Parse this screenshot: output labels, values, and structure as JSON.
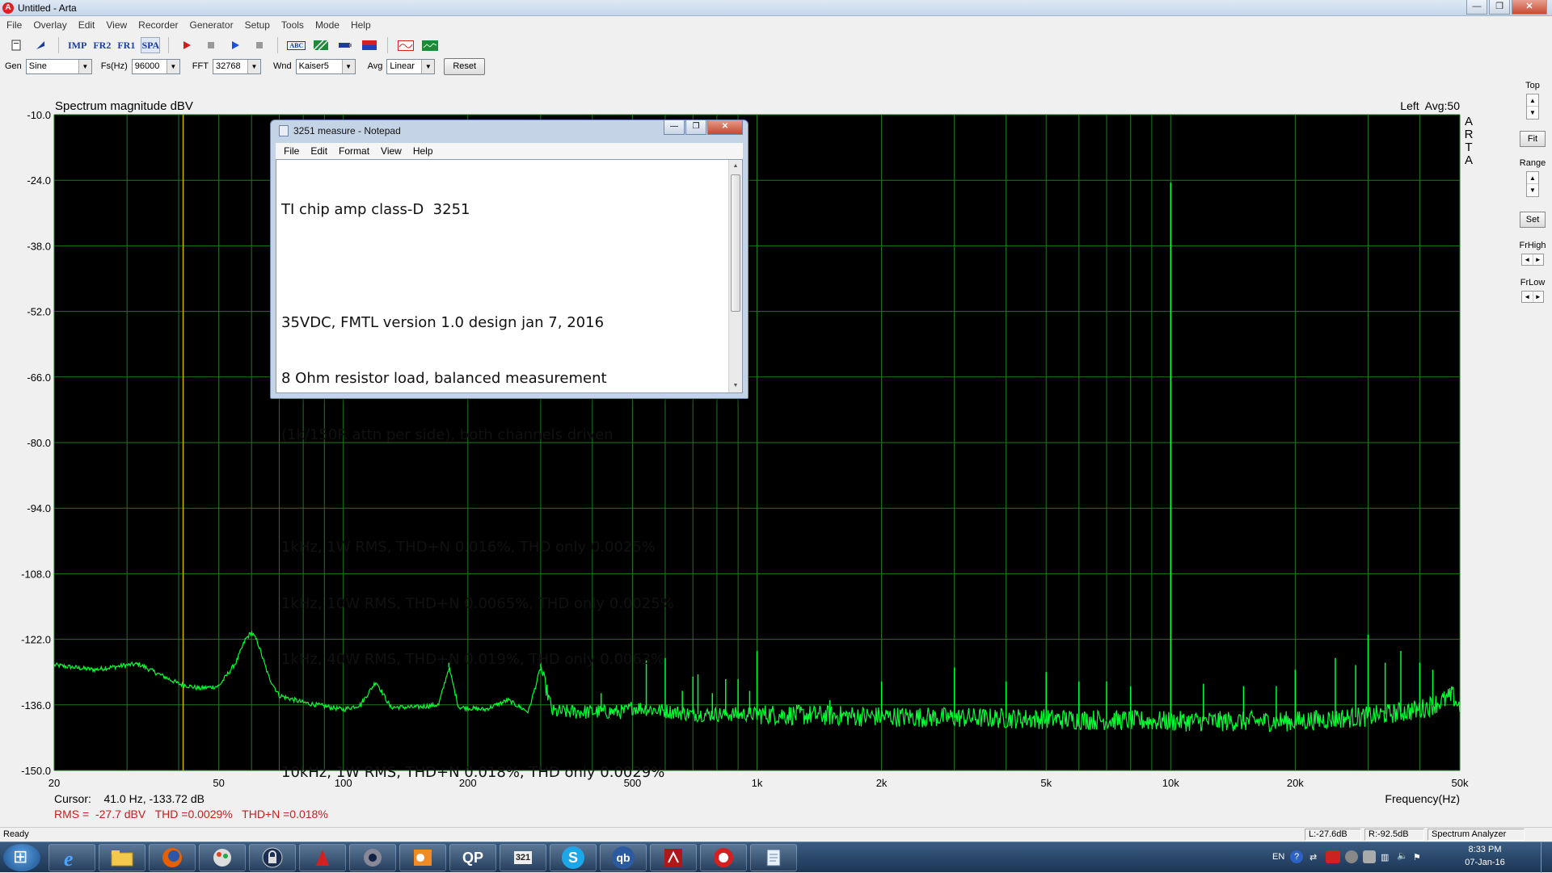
{
  "window": {
    "title": "Untitled - Arta",
    "app_icon_letter": "A"
  },
  "menu": [
    "File",
    "Overlay",
    "Edit",
    "View",
    "Recorder",
    "Generator",
    "Setup",
    "Tools",
    "Mode",
    "Help"
  ],
  "toolbar": {
    "imp": "IMP",
    "fr2": "FR2",
    "fr1": "FR1",
    "spa": "SPA",
    "abc": "ABC"
  },
  "controls": {
    "gen_label": "Gen",
    "gen_value": "Sine",
    "fs_label": "Fs(Hz)",
    "fs_value": "96000",
    "fft_label": "FFT",
    "fft_value": "32768",
    "wnd_label": "Wnd",
    "wnd_value": "Kaiser5",
    "avg_label": "Avg",
    "avg_value": "Linear",
    "reset_label": "Reset"
  },
  "right_panel": {
    "top_label": "Top",
    "fit_label": "Fit",
    "range_label": "Range",
    "set_label": "Set",
    "frhigh_label": "FrHigh",
    "frlow_label": "FrLow"
  },
  "chart_data": {
    "type": "line",
    "title": "Spectrum magnitude dBV",
    "xlabel": "Frequency(Hz)",
    "ylabel": "",
    "channel_info": "Left  Avg:50",
    "side_logo": [
      "A",
      "R",
      "T",
      "A"
    ],
    "x_scale": "log",
    "xlim": [
      20,
      50000
    ],
    "ylim": [
      -150,
      -10
    ],
    "yticks": [
      "-10.0",
      "-24.0",
      "-38.0",
      "-52.0",
      "-66.0",
      "-80.0",
      "-94.0",
      "-108.0",
      "-122.0",
      "-136.0",
      "-150.0"
    ],
    "xticks": [
      {
        "v": 20,
        "t": "20"
      },
      {
        "v": 50,
        "t": "50"
      },
      {
        "v": 100,
        "t": "100"
      },
      {
        "v": 200,
        "t": "200"
      },
      {
        "v": 500,
        "t": "500"
      },
      {
        "v": 1000,
        "t": "1k"
      },
      {
        "v": 2000,
        "t": "2k"
      },
      {
        "v": 5000,
        "t": "5k"
      },
      {
        "v": 10000,
        "t": "10k"
      },
      {
        "v": 20000,
        "t": "20k"
      },
      {
        "v": 50000,
        "t": "50k"
      }
    ],
    "grid": true,
    "background": "#000000",
    "grid_color": "#1e7a1e",
    "trace_color": "#00ff33",
    "cursor_color": "#c8b400",
    "cursor_freq": 41.0,
    "noise_floor_db": -137.5,
    "series": [
      {
        "points": [
          [
            20,
            -127.5
          ],
          [
            25,
            -128.5
          ],
          [
            30,
            -127.5
          ],
          [
            32,
            -127.3
          ],
          [
            35,
            -129.0
          ],
          [
            40,
            -131.5
          ],
          [
            45,
            -132.5
          ],
          [
            50,
            -132.0
          ],
          [
            55,
            -127.0
          ],
          [
            58,
            -122.0
          ],
          [
            60,
            -120.5
          ],
          [
            62,
            -122.5
          ],
          [
            66,
            -130.0
          ],
          [
            70,
            -134.0
          ],
          [
            80,
            -135.5
          ],
          [
            100,
            -137.0
          ],
          [
            110,
            -136.0
          ],
          [
            120,
            -131.0
          ],
          [
            130,
            -136.5
          ],
          [
            150,
            -136.5
          ],
          [
            170,
            -136.0
          ],
          [
            180,
            -128.0
          ],
          [
            190,
            -136.5
          ],
          [
            220,
            -137.0
          ],
          [
            250,
            -135.0
          ],
          [
            280,
            -137.5
          ],
          [
            300,
            -128.0
          ],
          [
            320,
            -137.5
          ],
          [
            400,
            -137.5
          ],
          [
            480,
            -137.5
          ],
          [
            500,
            -136.5
          ],
          [
            700,
            -138.0
          ],
          [
            1000,
            -138.0
          ],
          [
            2000,
            -138.5
          ],
          [
            5000,
            -139.0
          ],
          [
            10000,
            -139.5
          ],
          [
            20000,
            -139.5
          ],
          [
            30000,
            -138.5
          ],
          [
            40000,
            -137.0
          ],
          [
            46000,
            -135.0
          ],
          [
            48000,
            -134.0
          ],
          [
            50000,
            -136.5
          ]
        ],
        "spikes": [
          [
            180,
            -127.0
          ],
          [
            300,
            -127.0
          ],
          [
            420,
            -133.5
          ],
          [
            540,
            -126.5
          ],
          [
            600,
            -126.0
          ],
          [
            660,
            -133.0
          ],
          [
            700,
            -130.0
          ],
          [
            720,
            -129.5
          ],
          [
            780,
            -133.5
          ],
          [
            840,
            -130.5
          ],
          [
            900,
            -130.5
          ],
          [
            960,
            -133.0
          ],
          [
            1000,
            -124.5
          ],
          [
            1500,
            -135.0
          ],
          [
            2000,
            -131.0
          ],
          [
            3000,
            -128.0
          ],
          [
            4000,
            -131.0
          ],
          [
            5000,
            -129.0
          ],
          [
            6000,
            -131.0
          ],
          [
            7000,
            -131.0
          ],
          [
            8000,
            -132.0
          ],
          [
            10000,
            -24.5
          ],
          [
            12000,
            -131.5
          ],
          [
            15000,
            -132.0
          ],
          [
            18000,
            -132.0
          ],
          [
            20000,
            -128.5
          ],
          [
            25000,
            -126.0
          ],
          [
            28000,
            -127.5
          ],
          [
            30000,
            -121.0
          ],
          [
            33000,
            -127.0
          ],
          [
            36000,
            -124.5
          ],
          [
            40000,
            -127.0
          ],
          [
            43000,
            -128.5
          ]
        ]
      }
    ]
  },
  "readouts": {
    "cursor": "Cursor:    41.0 Hz, -133.72 dB",
    "measurements": "RMS =  -27.7 dBV   THD =0.0029%   THD+N =0.018%"
  },
  "notepad": {
    "title": "3251 measure - Notepad",
    "menu": [
      "File",
      "Edit",
      "Format",
      "View",
      "Help"
    ],
    "lines": [
      "TI chip amp class-D  3251",
      "",
      "35VDC, FMTL version 1.0 design jan 7, 2016",
      "8 Ohm resistor load, balanced measurement",
      "(1k/150R attn per side), both channels driven",
      "",
      "1kHz, 1W RMS, THD+N 0.016%, THD only 0.0025%",
      "1kHz, 10W RMS, THD+N 0.0065%, THD only 0.0025%",
      "1kHz, 40W RMS, THD+N 0.019%, THD only 0.0063%",
      "",
      "10kHz, 1W RMS, THD+N 0.018%, THD only 0.0029%"
    ]
  },
  "status": {
    "ready": "Ready",
    "left": "L:-27.6dB",
    "right": "R:-92.5dB",
    "mode": "Spectrum Analyzer"
  },
  "taskbar": {
    "language": "EN",
    "time": "8:33 PM",
    "date": "07-Jan-16",
    "apps": [
      "ie-icon",
      "folder-icon",
      "firefox-icon",
      "paint-icon",
      "lock-icon",
      "acrobat-icon",
      "webcam-icon",
      "outlook-icon",
      "quattro-icon",
      "calendar-icon",
      "skype-icon",
      "qb-icon",
      "pdf-icon",
      "arta-icon",
      "notepad-icon"
    ],
    "app_labels": {
      "quattro": "QP",
      "calendar": "321",
      "skype": "S",
      "qb": "qb"
    }
  }
}
